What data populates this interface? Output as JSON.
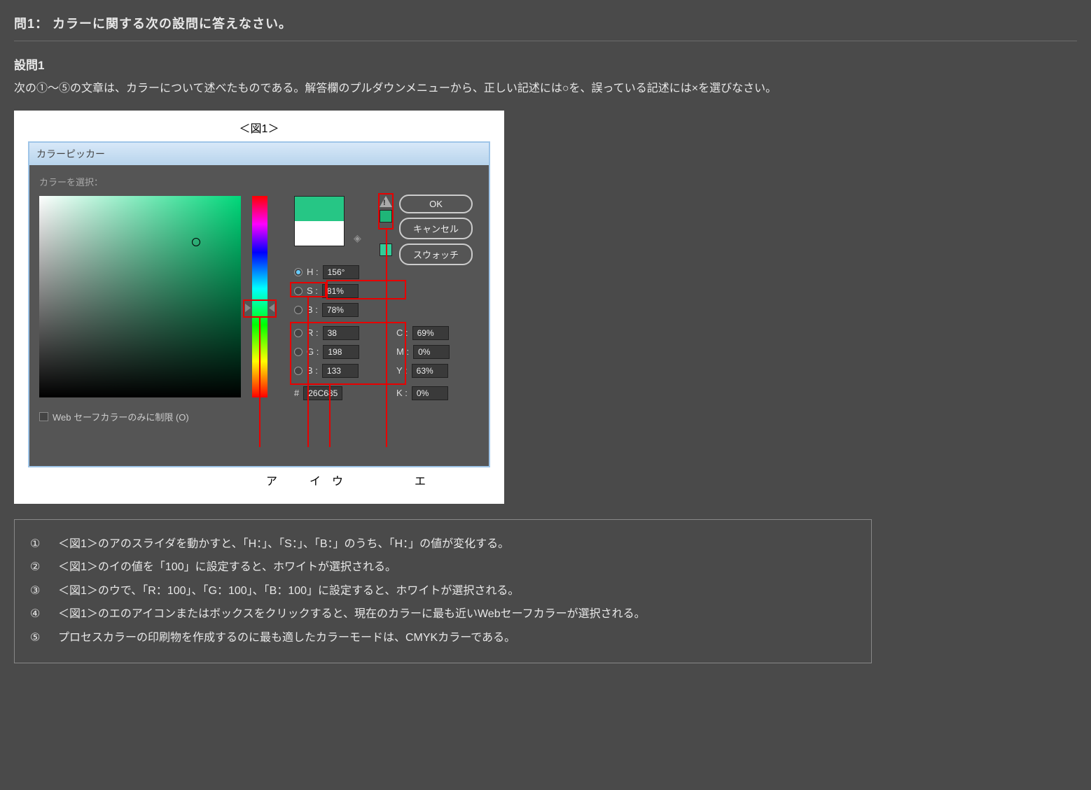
{
  "question_title": "問1：  カラーに関する次の設問に答えなさい。",
  "sub_title": "設問1",
  "instruction": "次の①～⑤の文章は、カラーについて述べたものである。解答欄のプルダウンメニューから、正しい記述には○を、誤っている記述には×を選びなさい。",
  "figure_label": "＜図1＞",
  "picker": {
    "title": "カラーピッカー",
    "select_label": "カラーを選択：",
    "web_safe_label": "Web セーフカラーのみに制限 (O)",
    "buttons": {
      "ok": "OK",
      "cancel": "キャンセル",
      "swatch": "スウォッチ"
    },
    "hsb": {
      "h_label": "H :",
      "h_value": "156°",
      "s_label": "S :",
      "s_value": "81%",
      "b_label": "B :",
      "b_value": "78%"
    },
    "rgb": {
      "r_label": "R :",
      "r_value": "38",
      "g_label": "G :",
      "g_value": "198",
      "b_label": "B :",
      "b_value": "133"
    },
    "hex": {
      "label": "#",
      "value": "26C685"
    },
    "cmyk": {
      "c_label": "C :",
      "c_value": "69%",
      "m_label": "M :",
      "m_value": "0%",
      "y_label": "Y :",
      "y_value": "63%",
      "k_label": "K :",
      "k_value": "0%"
    }
  },
  "annotations": {
    "a": "ア",
    "i": "イ",
    "u": "ウ",
    "e": "エ"
  },
  "statements": [
    {
      "num": "①",
      "text": "＜図1＞のアのスライダを動かすと、「H：」、「S：」、「B：」のうち、「H：」の値が変化する。"
    },
    {
      "num": "②",
      "text": "＜図1＞のイの値を「100」に設定すると、ホワイトが選択される。"
    },
    {
      "num": "③",
      "text": "＜図1＞のウで、「R：100」、「G：100」、「B：100」に設定すると、ホワイトが選択される。"
    },
    {
      "num": "④",
      "text": "＜図1＞のエのアイコンまたはボックスをクリックすると、現在のカラーに最も近いWebセーフカラーが選択される。"
    },
    {
      "num": "⑤",
      "text": "プロセスカラーの印刷物を作成するのに最も適したカラーモードは、CMYKカラーである。"
    }
  ]
}
